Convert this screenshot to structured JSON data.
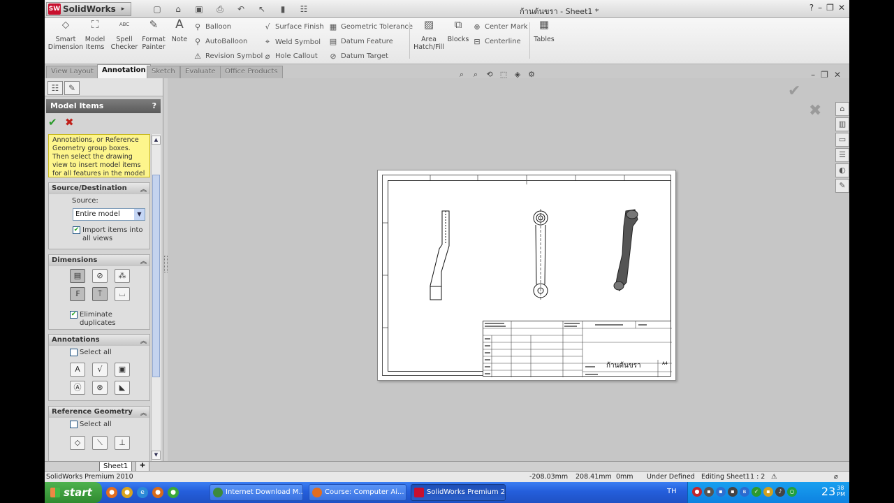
{
  "app": {
    "brand": "SolidWorks",
    "logo_badge": "SW",
    "document_title": "ก้านต้นขรา - Sheet1 *"
  },
  "window_controls": [
    "?",
    "–",
    "❐",
    "✕"
  ],
  "ribbon": {
    "smart_dimension": "Smart Dimension",
    "model_items": "Model Items",
    "spell_checker": "Spell Checker",
    "spell_abc": "ABC",
    "format_painter": "Format Painter",
    "note": "Note",
    "balloon": "Balloon",
    "autoballoon": "AutoBalloon",
    "revision_symbol": "Revision Symbol",
    "surface_finish": "Surface Finish",
    "weld_symbol": "Weld Symbol",
    "hole_callout": "Hole Callout",
    "geometric_tolerance": "Geometric Tolerance",
    "datum_feature": "Datum Feature",
    "datum_target": "Datum Target",
    "area_hatch": "Area Hatch/Fill",
    "blocks": "Blocks",
    "center_mark": "Center Mark",
    "centerline": "Centerline",
    "tables": "Tables"
  },
  "tabs": [
    "View Layout",
    "Annotation",
    "Sketch",
    "Evaluate",
    "Office Products"
  ],
  "property_manager": {
    "title": "Model Items",
    "help": "?",
    "message": "Annotations, or Reference Geometry group boxes. Then select the drawing view to insert model items for all features in the model",
    "source_destination": {
      "title": "Source/Destination",
      "source_label": "Source:",
      "source_value": "Entire model",
      "import_all_label": "Import items into all views",
      "import_all_checked": true
    },
    "dimensions": {
      "title": "Dimensions",
      "eliminate_duplicates_label": "Eliminate duplicates",
      "eliminate_duplicates_checked": true
    },
    "annotations": {
      "title": "Annotations",
      "select_all_label": "Select all",
      "select_all_checked": false
    },
    "reference_geometry": {
      "title": "Reference Geometry",
      "select_all_label": "Select all",
      "select_all_checked": false
    }
  },
  "sheet_tab": "Sheet1",
  "title_block": {
    "part_name": "ก้านต้นขรา",
    "sheet_size": "A4"
  },
  "status_bar": {
    "product": "SolidWorks Premium 2010",
    "x": "-208.03mm",
    "y": "208.41mm",
    "z": "0mm",
    "state": "Under Defined",
    "editing": "Editing Sheet1",
    "scale": "1 : 2"
  },
  "taskbar": {
    "start": "start",
    "buttons": [
      "Internet Download M...",
      "Course: Computer Ai...",
      "SolidWorks Premium 2..."
    ],
    "language": "TH",
    "clock_hour": "23",
    "clock_min": "38",
    "clock_ampm": "PM"
  }
}
